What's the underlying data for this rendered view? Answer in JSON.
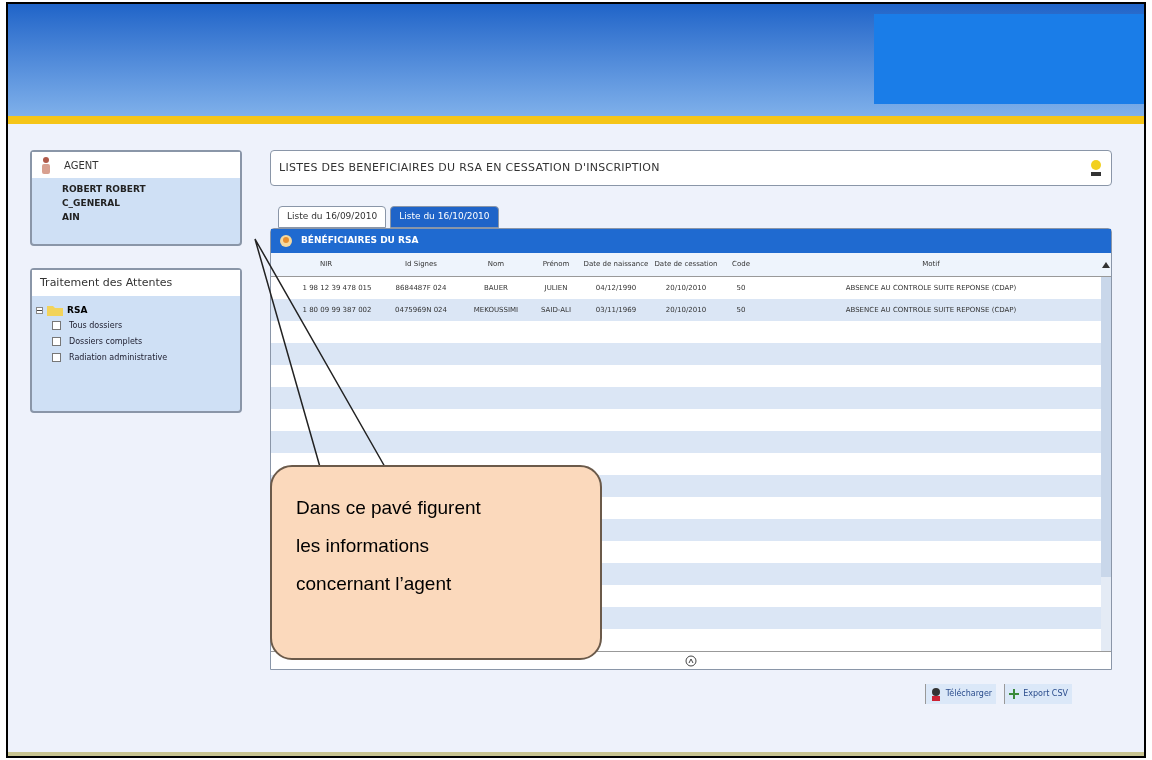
{
  "agent_panel": {
    "title": "AGENT",
    "lines": [
      "ROBERT ROBERT",
      "C_GENERAL",
      "AIN"
    ]
  },
  "treatment_panel": {
    "title": "Traitement des Attentes",
    "tree": [
      {
        "label": "RSA",
        "expanded": true,
        "children": [
          {
            "label": "Tous dossiers",
            "checked": false
          },
          {
            "label": "Dossiers complets",
            "checked": false
          },
          {
            "label": "Radiation administrative",
            "checked": false
          }
        ]
      }
    ]
  },
  "page_title": "LISTES DES BENEFICIAIRES DU RSA EN CESSATION D'INSCRIPTION",
  "tabs": [
    {
      "label": "Liste du 16/09/2010",
      "selected": false
    },
    {
      "label": "Liste du 16/10/2010",
      "selected": true
    }
  ],
  "grid": {
    "title": "BÉNÉFICIAIRES DU RSA",
    "columns": [
      "NIR",
      "Id Signes",
      "Nom",
      "Prénom",
      "Date de naissance",
      "Date de cessation",
      "Code",
      "Motif"
    ],
    "rows": [
      [
        "1 98 12 39 478 015",
        "8684487F 024",
        "BAUER",
        "JULIEN",
        "04/12/1990",
        "20/10/2010",
        "50",
        "ABSENCE AU CONTROLE SUITE REPONSE (CDAP)"
      ],
      [
        "1 80 09 99 387 002",
        "0475969N 024",
        "MEKOUSSIMI",
        "SAID-ALI",
        "03/11/1969",
        "20/10/2010",
        "50",
        "ABSENCE AU CONTROLE SUITE REPONSE (CDAP)"
      ]
    ]
  },
  "footer_buttons": [
    {
      "label": "Télécharger",
      "kind": "download"
    },
    {
      "label": "Export CSV",
      "kind": "export"
    }
  ],
  "callout": "Dans ce pavé figurent les informations concernant l’agent"
}
